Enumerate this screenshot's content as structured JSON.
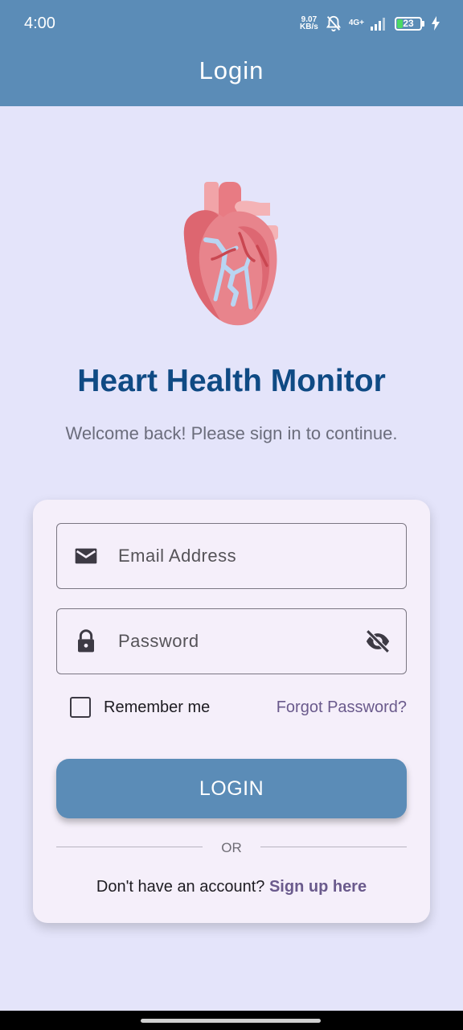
{
  "status_bar": {
    "time": "4:00",
    "net_speed_value": "9.07",
    "net_speed_unit": "KB/s",
    "network": "4G+",
    "battery": "23",
    "battery_level": 0.23
  },
  "appbar": {
    "title": "Login"
  },
  "header": {
    "app_title": "Heart Health Monitor",
    "subtitle": "Welcome back! Please sign in to continue."
  },
  "form": {
    "email_placeholder": "Email Address",
    "email_value": "",
    "password_placeholder": "Password",
    "password_value": "",
    "remember_label": "Remember me",
    "remember_checked": false,
    "forgot_label": "Forgot Password?",
    "login_label": "LOGIN",
    "divider_text": "OR",
    "signup_prompt": "Don't have an account?",
    "signup_link": "Sign up here"
  },
  "icons": {
    "email": "email-icon",
    "password": "lock-icon",
    "visibility": "eye-off-icon",
    "logo": "heart-icon"
  },
  "colors": {
    "appbar": "#5b8cb7",
    "background": "#e4e4fa",
    "title": "#0f4a84",
    "link": "#6a5a8c",
    "button": "#5b8cb7"
  }
}
